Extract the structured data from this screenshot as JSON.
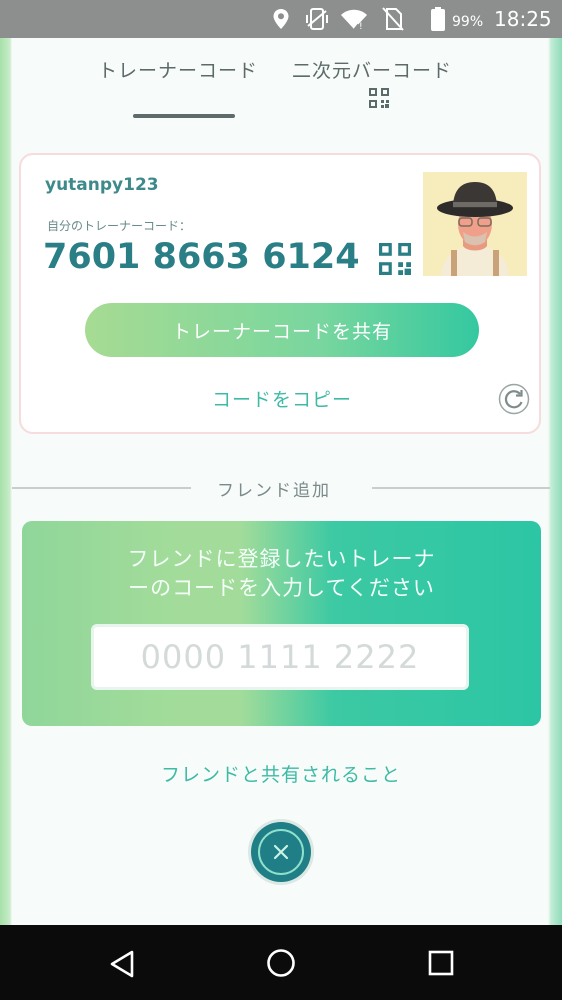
{
  "status_bar": {
    "battery_percent": "99%",
    "time": "18:25",
    "icons": [
      "location-icon",
      "vibrate-icon",
      "wifi-icon",
      "no-sim-icon",
      "battery-icon"
    ]
  },
  "tabs": [
    {
      "label": "トレーナーコード",
      "active": true
    },
    {
      "label": "二次元バーコード",
      "active": false
    }
  ],
  "card": {
    "username": "yutanpy123",
    "code_label": "自分のトレーナーコード：",
    "code_value": "7601 8663 6124",
    "share_button": "トレーナーコードを共有",
    "copy_link": "コードをコピー"
  },
  "add_friend": {
    "divider_label": "フレンド追加",
    "prompt_line1": "フレンドに登録したいトレーナ",
    "prompt_line2": "ーのコードを入力してください",
    "input_placeholder": "0000 1111 2222",
    "input_value": ""
  },
  "friends_share_link": "フレンドと共有されること",
  "colors": {
    "accent_teal": "#3ebba6",
    "code_text": "#2a7e86",
    "status_bar": "#8d8e8e",
    "nav_bar": "#0b0b0b"
  },
  "nav_bar": {
    "icons": [
      "back-icon",
      "home-icon",
      "recents-icon"
    ]
  }
}
